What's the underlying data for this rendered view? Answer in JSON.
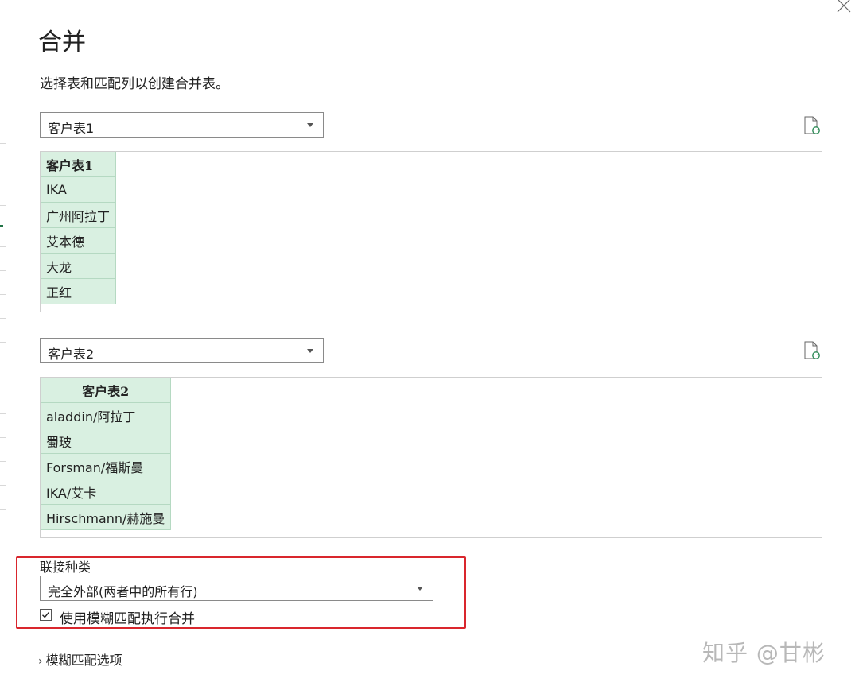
{
  "dialog": {
    "title": "合并",
    "subtitle": "选择表和匹配列以创建合并表。"
  },
  "table1": {
    "selected": "客户表1",
    "column_header": "客户表1",
    "rows": [
      "IKA",
      "广州阿拉丁",
      "艾本德",
      "大龙",
      "正红"
    ]
  },
  "table2": {
    "selected": "客户表2",
    "column_header": "客户表2",
    "rows": [
      "aladdin/阿拉丁",
      "蜀玻",
      "Forsman/福斯曼",
      "IKA/艾卡",
      "Hirschmann/赫施曼"
    ]
  },
  "join": {
    "label": "联接种类",
    "selected": "完全外部(两者中的所有行)",
    "fuzzy_checkbox_label": "使用模糊匹配执行合并",
    "fuzzy_checked": true,
    "fuzzy_options_label": "模糊匹配选项"
  },
  "watermark": "知乎 @甘彬",
  "colors": {
    "table_cell_bg": "#d9f0e1",
    "highlight_box": "#d9262d",
    "refresh_icon_accent": "#2e8b57"
  }
}
